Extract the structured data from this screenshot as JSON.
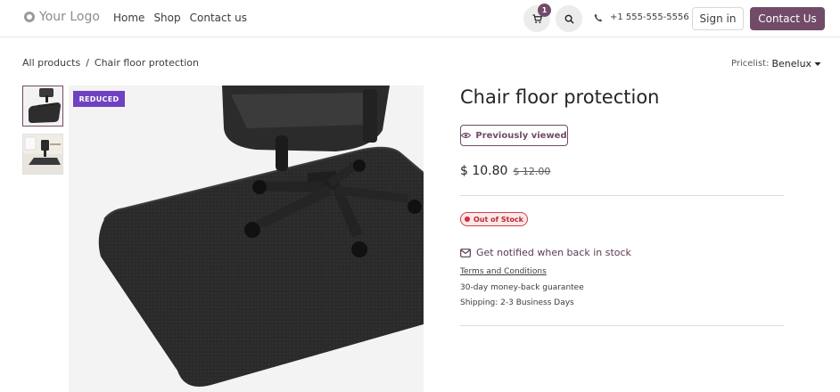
{
  "header": {
    "logo_text": "Your Logo",
    "nav": [
      "Home",
      "Shop",
      "Contact us"
    ],
    "cart_count": "1",
    "phone": "+1 555-555-5556",
    "signin_label": "Sign in",
    "contact_label": "Contact Us"
  },
  "breadcrumb": {
    "root": "All products",
    "separator": "/",
    "current": "Chair floor protection"
  },
  "pricelist": {
    "label": "Pricelist:",
    "value": "Benelux"
  },
  "product": {
    "badge": "REDUCED",
    "title": "Chair floor protection",
    "previously_viewed": "Previously viewed",
    "price": "$ 10.80",
    "old_price": "$ 12.00",
    "stock_status": "Out of Stock",
    "notify_label": "Get notified when back in stock",
    "terms_label": "Terms and Conditions",
    "guarantee": "30-day money-back guarantee",
    "shipping": "Shipping: 2-3 Business Days"
  },
  "colors": {
    "brand": "#714b67",
    "badge_purple": "#6f42c1",
    "out_of_stock": "#d92b3a"
  },
  "icons": [
    "cart-icon",
    "search-icon",
    "phone-icon",
    "eye-icon",
    "envelope-icon",
    "caret-down-icon"
  ]
}
